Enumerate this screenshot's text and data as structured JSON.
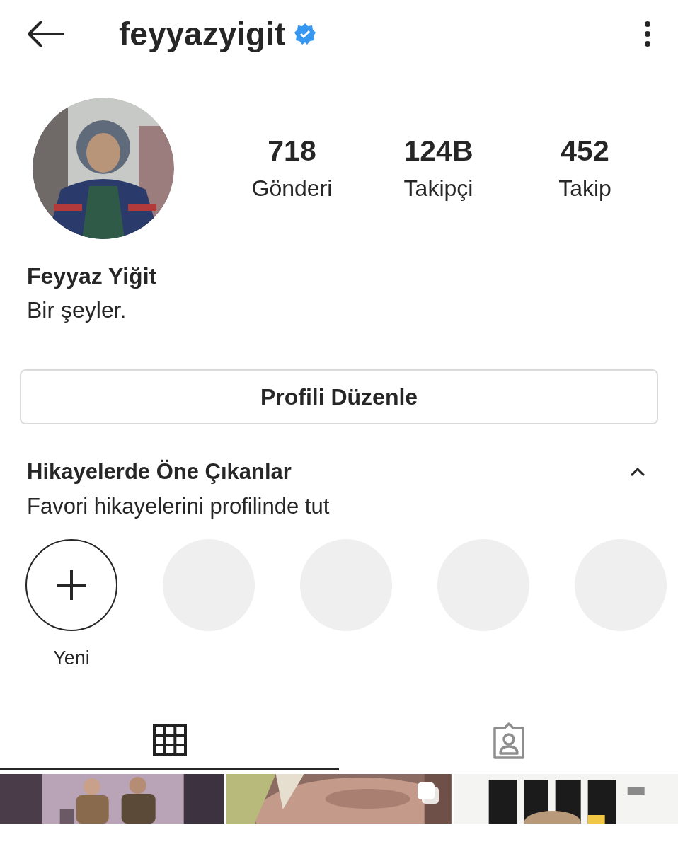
{
  "header": {
    "username": "feyyazyigit",
    "verified": true
  },
  "profile": {
    "avatar": {
      "kind": "picture"
    },
    "name": "Feyyaz Yiğit",
    "bio": "Bir şeyler."
  },
  "stats": [
    {
      "value": "718",
      "label": "Gönderi"
    },
    {
      "value": "124B",
      "label": "Takipçi"
    },
    {
      "value": "452",
      "label": "Takip"
    }
  ],
  "edit_button": "Profili Düzenle",
  "highlights": {
    "title": "Hikayelerde Öne Çıkanlar",
    "subtitle": "Favori hikayelerini profilinde tut",
    "expanded": true,
    "items": [
      {
        "kind": "new",
        "label": "Yeni"
      },
      {
        "kind": "placeholder"
      },
      {
        "kind": "placeholder"
      },
      {
        "kind": "placeholder"
      },
      {
        "kind": "placeholder"
      }
    ]
  },
  "tabs": [
    {
      "kind": "grid",
      "selected": true
    },
    {
      "kind": "tagged",
      "selected": false
    }
  ],
  "posts": [
    {
      "kind": "picture",
      "multiple": false
    },
    {
      "kind": "picture",
      "multiple": true
    },
    {
      "kind": "picture",
      "multiple": false
    }
  ]
}
